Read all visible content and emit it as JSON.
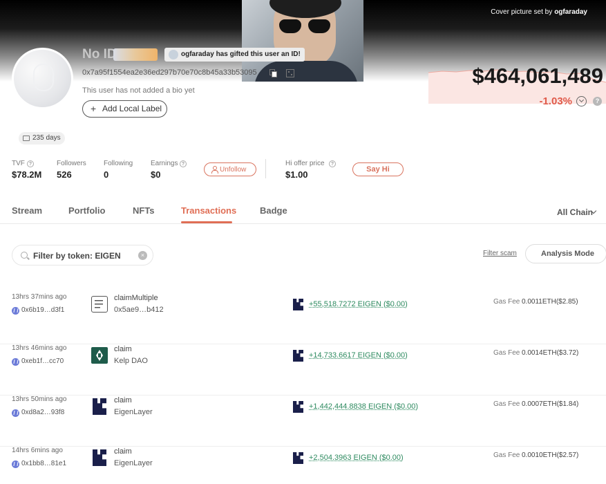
{
  "cover": {
    "credit_prefix": "Cover picture set by",
    "credit_user": "ogfaraday"
  },
  "profile": {
    "name": "No ID",
    "gift_badge_user": "ogfaraday",
    "gift_badge_text": "has gifted this user an ID!",
    "address": "0x7a95f1554ea2e36ed297b70e70c8b45a33b53095",
    "bio": "This user has not added a bio yet",
    "add_label": "Add Local Label",
    "days": "235 days"
  },
  "balance": {
    "value": "$464,061,489",
    "change": "-1.03%",
    "change_color": "#e05a4a"
  },
  "stats": {
    "tvf_label": "TVF",
    "tvf_value": "$78.2M",
    "followers_label": "Followers",
    "followers_value": "526",
    "following_label": "Following",
    "following_value": "0",
    "earnings_label": "Earnings",
    "earnings_value": "$0",
    "unfollow_label": "Unfollow",
    "hi_offer_label": "Hi offer price",
    "hi_offer_value": "$1.00",
    "say_hi_label": "Say Hi"
  },
  "tabs": [
    {
      "label": "Stream"
    },
    {
      "label": "Portfolio"
    },
    {
      "label": "NFTs"
    },
    {
      "label": "Transactions"
    },
    {
      "label": "Badge"
    }
  ],
  "active_tab": "Transactions",
  "chain_filter": "All Chain",
  "filter": {
    "value": "Filter by token: EIGEN",
    "filter_scam": "Filter scam",
    "analysis_mode": "Analysis Mode"
  },
  "transactions": [
    {
      "time": "13hrs 37mins ago",
      "hash": "0x6b19…d3f1",
      "icon": "contract-icon",
      "method": "claimMultiple",
      "target": "0x5ae9…b412",
      "amount": "+55,518.7272 EIGEN ($0.00)",
      "gas_label": "Gas Fee",
      "gas": "0.0011ETH($2.85)"
    },
    {
      "time": "13hrs 46mins ago",
      "hash": "0xeb1f…cc70",
      "icon": "kelp-dao-icon",
      "method": "claim",
      "target": "Kelp DAO",
      "amount": "+14,733.6617 EIGEN ($0.00)",
      "gas_label": "Gas Fee",
      "gas": "0.0014ETH($3.72)"
    },
    {
      "time": "13hrs 50mins ago",
      "hash": "0xd8a2…93f8",
      "icon": "eigenlayer-icon",
      "method": "claim",
      "target": "EigenLayer",
      "amount": "+1,442,444.8838 EIGEN ($0.00)",
      "gas_label": "Gas Fee",
      "gas": "0.0007ETH($1.84)"
    },
    {
      "time": "14hrs 6mins ago",
      "hash": "0x1bb8…81e1",
      "icon": "eigenlayer-icon",
      "method": "claim",
      "target": "EigenLayer",
      "amount": "+2,504.3963 EIGEN ($0.00)",
      "gas_label": "Gas Fee",
      "gas": "0.0010ETH($2.57)"
    }
  ],
  "colors": {
    "accent": "#e06e55",
    "positive": "#2d8a5f"
  }
}
